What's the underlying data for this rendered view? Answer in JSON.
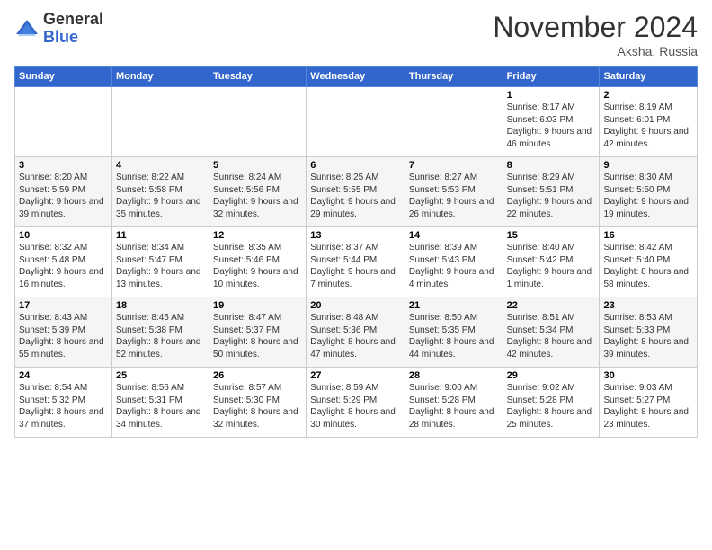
{
  "header": {
    "logo_general": "General",
    "logo_blue": "Blue",
    "month_title": "November 2024",
    "location": "Aksha, Russia"
  },
  "weekdays": [
    "Sunday",
    "Monday",
    "Tuesday",
    "Wednesday",
    "Thursday",
    "Friday",
    "Saturday"
  ],
  "weeks": [
    [
      {
        "day": "",
        "info": ""
      },
      {
        "day": "",
        "info": ""
      },
      {
        "day": "",
        "info": ""
      },
      {
        "day": "",
        "info": ""
      },
      {
        "day": "",
        "info": ""
      },
      {
        "day": "1",
        "info": "Sunrise: 8:17 AM\nSunset: 6:03 PM\nDaylight: 9 hours and 46 minutes."
      },
      {
        "day": "2",
        "info": "Sunrise: 8:19 AM\nSunset: 6:01 PM\nDaylight: 9 hours and 42 minutes."
      }
    ],
    [
      {
        "day": "3",
        "info": "Sunrise: 8:20 AM\nSunset: 5:59 PM\nDaylight: 9 hours and 39 minutes."
      },
      {
        "day": "4",
        "info": "Sunrise: 8:22 AM\nSunset: 5:58 PM\nDaylight: 9 hours and 35 minutes."
      },
      {
        "day": "5",
        "info": "Sunrise: 8:24 AM\nSunset: 5:56 PM\nDaylight: 9 hours and 32 minutes."
      },
      {
        "day": "6",
        "info": "Sunrise: 8:25 AM\nSunset: 5:55 PM\nDaylight: 9 hours and 29 minutes."
      },
      {
        "day": "7",
        "info": "Sunrise: 8:27 AM\nSunset: 5:53 PM\nDaylight: 9 hours and 26 minutes."
      },
      {
        "day": "8",
        "info": "Sunrise: 8:29 AM\nSunset: 5:51 PM\nDaylight: 9 hours and 22 minutes."
      },
      {
        "day": "9",
        "info": "Sunrise: 8:30 AM\nSunset: 5:50 PM\nDaylight: 9 hours and 19 minutes."
      }
    ],
    [
      {
        "day": "10",
        "info": "Sunrise: 8:32 AM\nSunset: 5:48 PM\nDaylight: 9 hours and 16 minutes."
      },
      {
        "day": "11",
        "info": "Sunrise: 8:34 AM\nSunset: 5:47 PM\nDaylight: 9 hours and 13 minutes."
      },
      {
        "day": "12",
        "info": "Sunrise: 8:35 AM\nSunset: 5:46 PM\nDaylight: 9 hours and 10 minutes."
      },
      {
        "day": "13",
        "info": "Sunrise: 8:37 AM\nSunset: 5:44 PM\nDaylight: 9 hours and 7 minutes."
      },
      {
        "day": "14",
        "info": "Sunrise: 8:39 AM\nSunset: 5:43 PM\nDaylight: 9 hours and 4 minutes."
      },
      {
        "day": "15",
        "info": "Sunrise: 8:40 AM\nSunset: 5:42 PM\nDaylight: 9 hours and 1 minute."
      },
      {
        "day": "16",
        "info": "Sunrise: 8:42 AM\nSunset: 5:40 PM\nDaylight: 8 hours and 58 minutes."
      }
    ],
    [
      {
        "day": "17",
        "info": "Sunrise: 8:43 AM\nSunset: 5:39 PM\nDaylight: 8 hours and 55 minutes."
      },
      {
        "day": "18",
        "info": "Sunrise: 8:45 AM\nSunset: 5:38 PM\nDaylight: 8 hours and 52 minutes."
      },
      {
        "day": "19",
        "info": "Sunrise: 8:47 AM\nSunset: 5:37 PM\nDaylight: 8 hours and 50 minutes."
      },
      {
        "day": "20",
        "info": "Sunrise: 8:48 AM\nSunset: 5:36 PM\nDaylight: 8 hours and 47 minutes."
      },
      {
        "day": "21",
        "info": "Sunrise: 8:50 AM\nSunset: 5:35 PM\nDaylight: 8 hours and 44 minutes."
      },
      {
        "day": "22",
        "info": "Sunrise: 8:51 AM\nSunset: 5:34 PM\nDaylight: 8 hours and 42 minutes."
      },
      {
        "day": "23",
        "info": "Sunrise: 8:53 AM\nSunset: 5:33 PM\nDaylight: 8 hours and 39 minutes."
      }
    ],
    [
      {
        "day": "24",
        "info": "Sunrise: 8:54 AM\nSunset: 5:32 PM\nDaylight: 8 hours and 37 minutes."
      },
      {
        "day": "25",
        "info": "Sunrise: 8:56 AM\nSunset: 5:31 PM\nDaylight: 8 hours and 34 minutes."
      },
      {
        "day": "26",
        "info": "Sunrise: 8:57 AM\nSunset: 5:30 PM\nDaylight: 8 hours and 32 minutes."
      },
      {
        "day": "27",
        "info": "Sunrise: 8:59 AM\nSunset: 5:29 PM\nDaylight: 8 hours and 30 minutes."
      },
      {
        "day": "28",
        "info": "Sunrise: 9:00 AM\nSunset: 5:28 PM\nDaylight: 8 hours and 28 minutes."
      },
      {
        "day": "29",
        "info": "Sunrise: 9:02 AM\nSunset: 5:28 PM\nDaylight: 8 hours and 25 minutes."
      },
      {
        "day": "30",
        "info": "Sunrise: 9:03 AM\nSunset: 5:27 PM\nDaylight: 8 hours and 23 minutes."
      }
    ]
  ]
}
